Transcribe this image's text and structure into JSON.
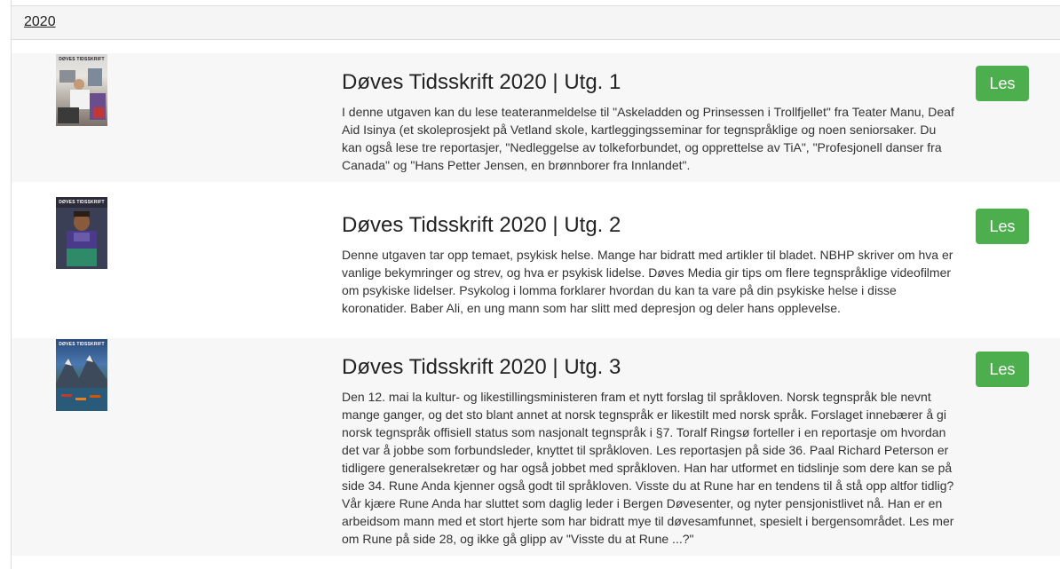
{
  "year": {
    "label": "2020"
  },
  "issues": [
    {
      "title": "Døves Tidsskrift 2020 | Utg. 1",
      "description": "I denne utgaven kan du lese teateranmeldelse til \"Askeladden og Prinsessen i Trollfjellet\" fra Teater Manu, Deaf Aid Isinya (et skoleprosjekt på Vetland skole, kartleggingsseminar for tegnspråklige og noen seniorsaker. Du kan også lese tre reportasjer, \"Nedleggelse av tolkeforbundet, og opprettelse av TiA\", \"Profesjonell danser fra Canada\" og \"Hans Petter Jensen, en brønnborer fra Innlandet\".",
      "button": "Les",
      "cover": {
        "masthead": "DØVES TIDSSKRIFT"
      }
    },
    {
      "title": "Døves Tidsskrift 2020 | Utg. 2",
      "description": "Denne utgaven tar opp temaet, psykisk helse. Mange har bidratt med artikler til bladet. NBHP skriver om hva er vanlige bekymringer og strev, og hva er psykisk lidelse. Døves Media gir tips om flere tegnspråklige videofilmer om psykiske lidelser. Psykolog i lomma forklarer hvordan du kan ta vare på din psykiske helse i disse koronatider. Baber Ali, en ung mann som har slitt med depresjon og deler hans opplevelse.",
      "button": "Les",
      "cover": {
        "masthead": "DØVES TIDSSKRIFT"
      }
    },
    {
      "title": "Døves Tidsskrift 2020 | Utg. 3",
      "description": "Den 12. mai la kultur- og likestillingsministeren fram et nytt forslag til språkloven. Norsk tegnspråk ble nevnt mange ganger, og det sto blant annet at norsk tegnspråk er likestilt med norsk språk. Forslaget innebærer å gi norsk tegnspråk offisiell status som nasjonalt tegnspråk i §7. Toralf Ringsø forteller i en reportasje om hvordan det var å jobbe som forbundsleder, knyttet til språkloven. Les reportasjen på side 36. Paal Richard Peterson er tidligere generalsekretær og har også jobbet med språkloven. Han har utformet en tidslinje som dere kan se på side 34. Rune Anda kjenner også godt til språkloven. Visste du at Rune har en tendens til å stå opp altfor tidlig? Vår kjære Rune Anda har sluttet som daglig leder i Bergen Døvesenter, og nyter pensjonistlivet nå. Han er en arbeidsom mann med et stort hjerte som har bidratt mye til døvesamfunnet, spesielt i bergensområdet. Les mer om Rune på side 28, og ikke gå glipp av \"Visste du at Rune ...?\"",
      "button": "Les",
      "cover": {
        "masthead": "DØVES TIDSSKRIFT"
      }
    }
  ]
}
